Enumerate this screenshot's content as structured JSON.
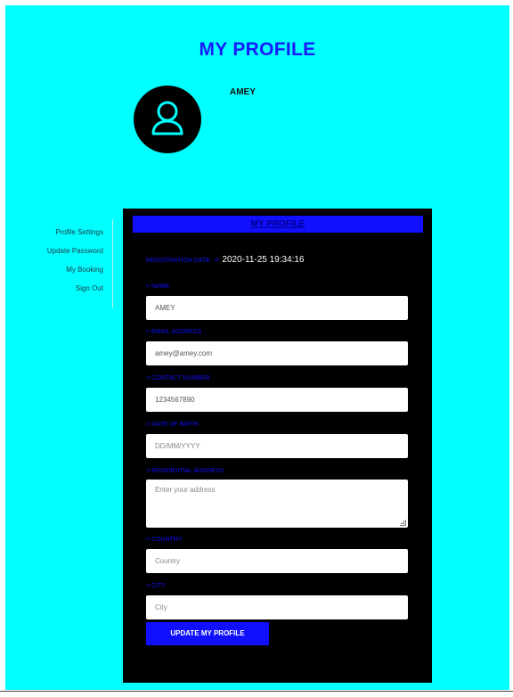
{
  "header": {
    "title": "MY PROFILE"
  },
  "profile": {
    "name": "AMEY",
    "avatar_icon": "user-icon"
  },
  "sidebar": {
    "items": [
      {
        "label": "Profile Settings"
      },
      {
        "label": "Update Password"
      },
      {
        "label": "My Booking"
      },
      {
        "label": "Sign Out"
      }
    ]
  },
  "form": {
    "header": "MY PROFILE",
    "registration_label": "REGISTRATION DATE",
    "registration_arrow": "->",
    "registration_value": "2020-11-25 19:34:16",
    "fields": {
      "name": {
        "label": "> NAME",
        "value": "AMEY",
        "placeholder": ""
      },
      "email": {
        "label": "> EMAIL ADDRESS",
        "value": "amey@amey.com",
        "placeholder": ""
      },
      "contact": {
        "label": "> CONTACT NUMBER",
        "value": "1234567890",
        "placeholder": ""
      },
      "dob": {
        "label": "> DATE OF BIRTH",
        "value": "",
        "placeholder": "DD/MM/YYYY"
      },
      "address": {
        "label": "> RESIDENTIAL ADDRESS",
        "value": "",
        "placeholder": "Enter your address"
      },
      "country": {
        "label": "> COUNTRY",
        "value": "",
        "placeholder": "Country"
      },
      "city": {
        "label": "> CITY",
        "value": "",
        "placeholder": "City"
      }
    },
    "submit_label": "UPDATE MY PROFILE"
  },
  "colors": {
    "background": "#00ffff",
    "accent": "#1010ff",
    "panel": "#000000",
    "title": "#1a1aff"
  }
}
